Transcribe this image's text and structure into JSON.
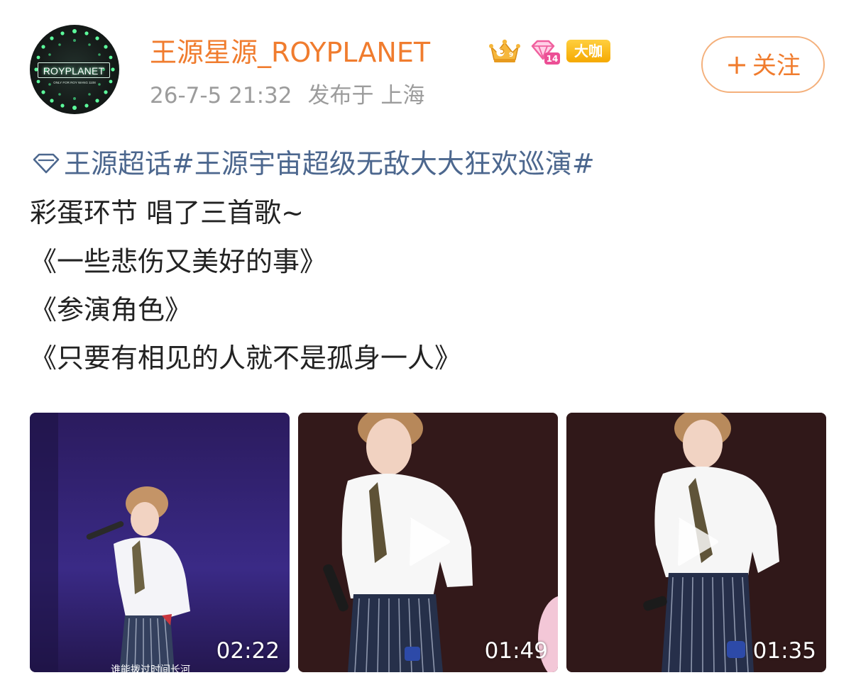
{
  "post": {
    "author": {
      "name": "王源星源_ROYPLANET",
      "avatar_text": "ROYPLANET",
      "avatar_subtext": "ONLY FOR ROY WANG 1108",
      "badges": [
        "crown-badge-icon",
        "diamond-level-badge-icon"
      ],
      "vip_badge": "大咖"
    },
    "meta": {
      "time": "26-7-5 21:32",
      "location": "发布于 上海"
    },
    "follow_button": {
      "plus": "+",
      "label": "关注"
    },
    "topic_line": {
      "icon": "supertopic-diamond-icon",
      "text": "王源超话#王源宇宙超级无敌大大狂欢巡演#"
    },
    "lines": [
      "彩蛋环节 唱了三首歌~",
      "《一些悲伤又美好的事》",
      "《参演角色》",
      "《只要有相见的人就不是孤身一人》"
    ],
    "videos": [
      {
        "duration": "02:22",
        "subtitle": "谁能拨过时间长河"
      },
      {
        "duration": "01:49",
        "play_icon": "play-icon"
      },
      {
        "duration": "01:35",
        "play_icon": "play-icon"
      }
    ]
  },
  "colors": {
    "username": "#f07c2e",
    "topic": "#4c678e",
    "meta": "#9c9c9c",
    "follow_border": "#f4b07b",
    "vip_badge": "#f5a900"
  }
}
